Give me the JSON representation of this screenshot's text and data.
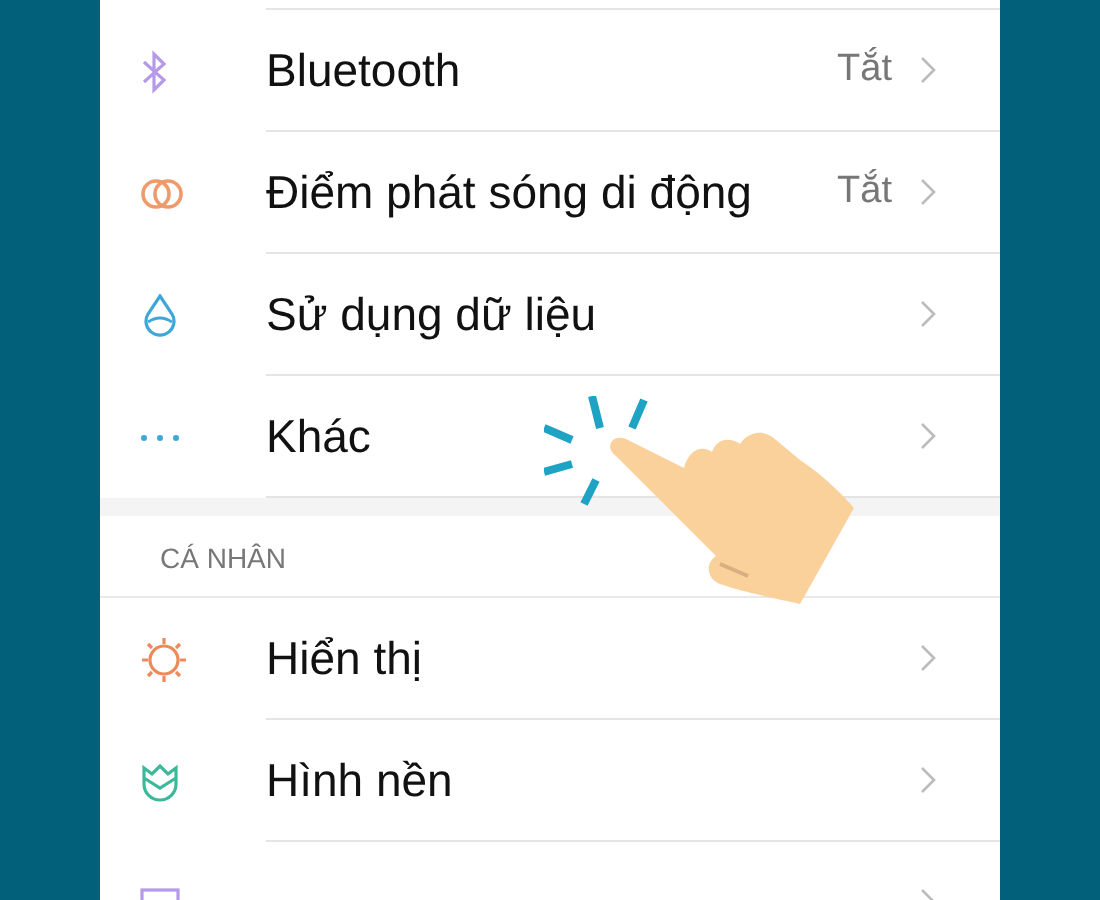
{
  "sections": [
    {
      "rows": [
        {
          "label": "Bluetooth",
          "value": "Tắt"
        },
        {
          "label": "Điểm phát sóng di động",
          "value": "Tắt"
        },
        {
          "label": "Sử dụng dữ liệu"
        },
        {
          "label": "Khác"
        }
      ]
    },
    {
      "header": "CÁ NHÂN",
      "rows": [
        {
          "label": "Hiển thị"
        },
        {
          "label": "Hình nền"
        },
        {}
      ]
    }
  ]
}
